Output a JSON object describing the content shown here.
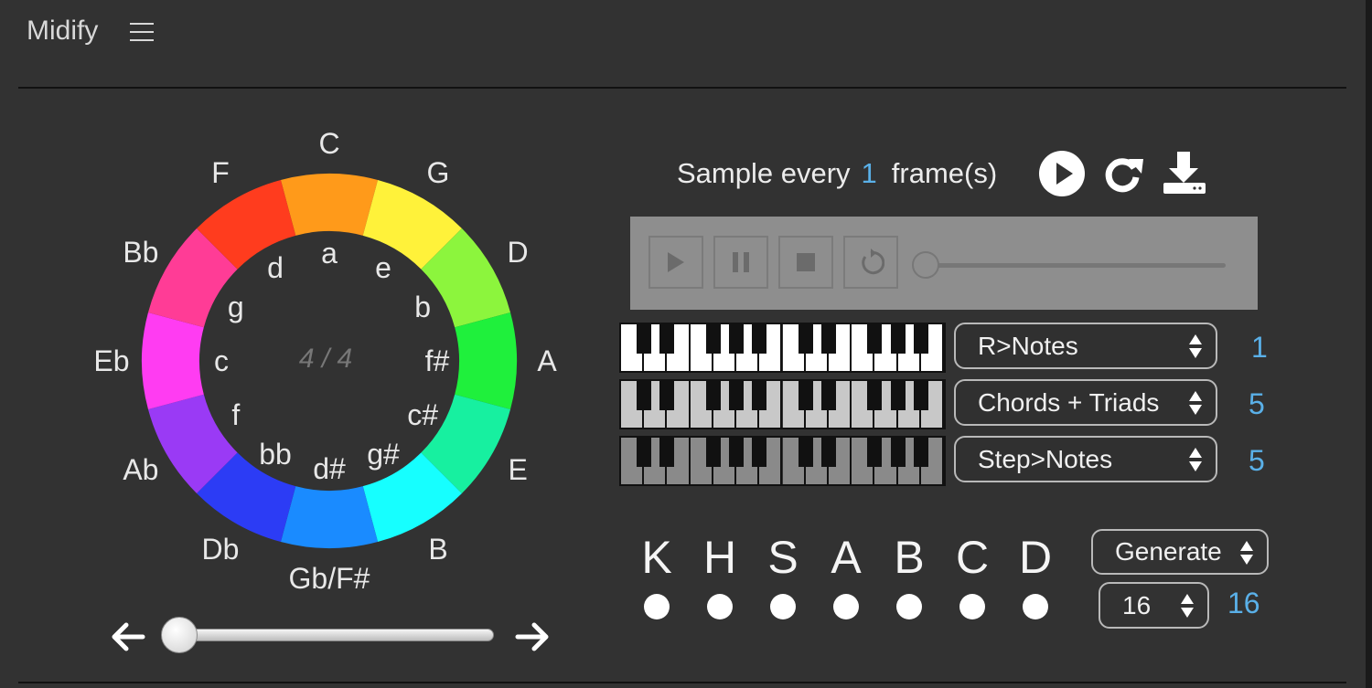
{
  "app": {
    "title": "Midify"
  },
  "wheel": {
    "meter": "4 / 4",
    "major_keys": [
      "C",
      "G",
      "D",
      "A",
      "E",
      "B",
      "Gb/F#",
      "Db",
      "Ab",
      "Eb",
      "Bb",
      "F"
    ],
    "minor_keys": [
      "a",
      "e",
      "b",
      "f#",
      "c#",
      "g#",
      "d#",
      "bb",
      "f",
      "c",
      "g",
      "d"
    ],
    "segment_colors": [
      "#ff9a1a",
      "#fff23a",
      "#8cf53d",
      "#1ff03c",
      "#17f0a0",
      "#16ffff",
      "#1a8bff",
      "#2c3cf5",
      "#9a3af5",
      "#ff3cf2",
      "#ff3c96",
      "#ff3c1e"
    ]
  },
  "knob": {
    "left_icon": "left-arrow-icon",
    "right_icon": "right-arrow-icon",
    "value": 0.0
  },
  "sampling": {
    "prefix": "Sample every",
    "value": "1",
    "suffix": "frame(s)"
  },
  "icons": {
    "play": "play-circle-icon",
    "reload": "reload-icon",
    "download": "download-icon"
  },
  "player": {
    "progress": 0.0,
    "buttons": [
      "play-icon",
      "pause-icon",
      "stop-icon",
      "replay-icon"
    ]
  },
  "tracks": [
    {
      "mode": "R>Notes",
      "count": "1",
      "keyboard_white": "#ffffff"
    },
    {
      "mode": "Chords + Triads",
      "count": "5",
      "keyboard_white": "#c8c8c8"
    },
    {
      "mode": "Step>Notes",
      "count": "5",
      "keyboard_white": "#8a8a8a"
    }
  ],
  "letters": [
    "K",
    "H",
    "S",
    "A",
    "B",
    "C",
    "D"
  ],
  "generate": {
    "label": "Generate",
    "steps": "16",
    "steps_display": "16"
  },
  "colors": {
    "accent": "#5ab0e8",
    "background": "#323232"
  }
}
